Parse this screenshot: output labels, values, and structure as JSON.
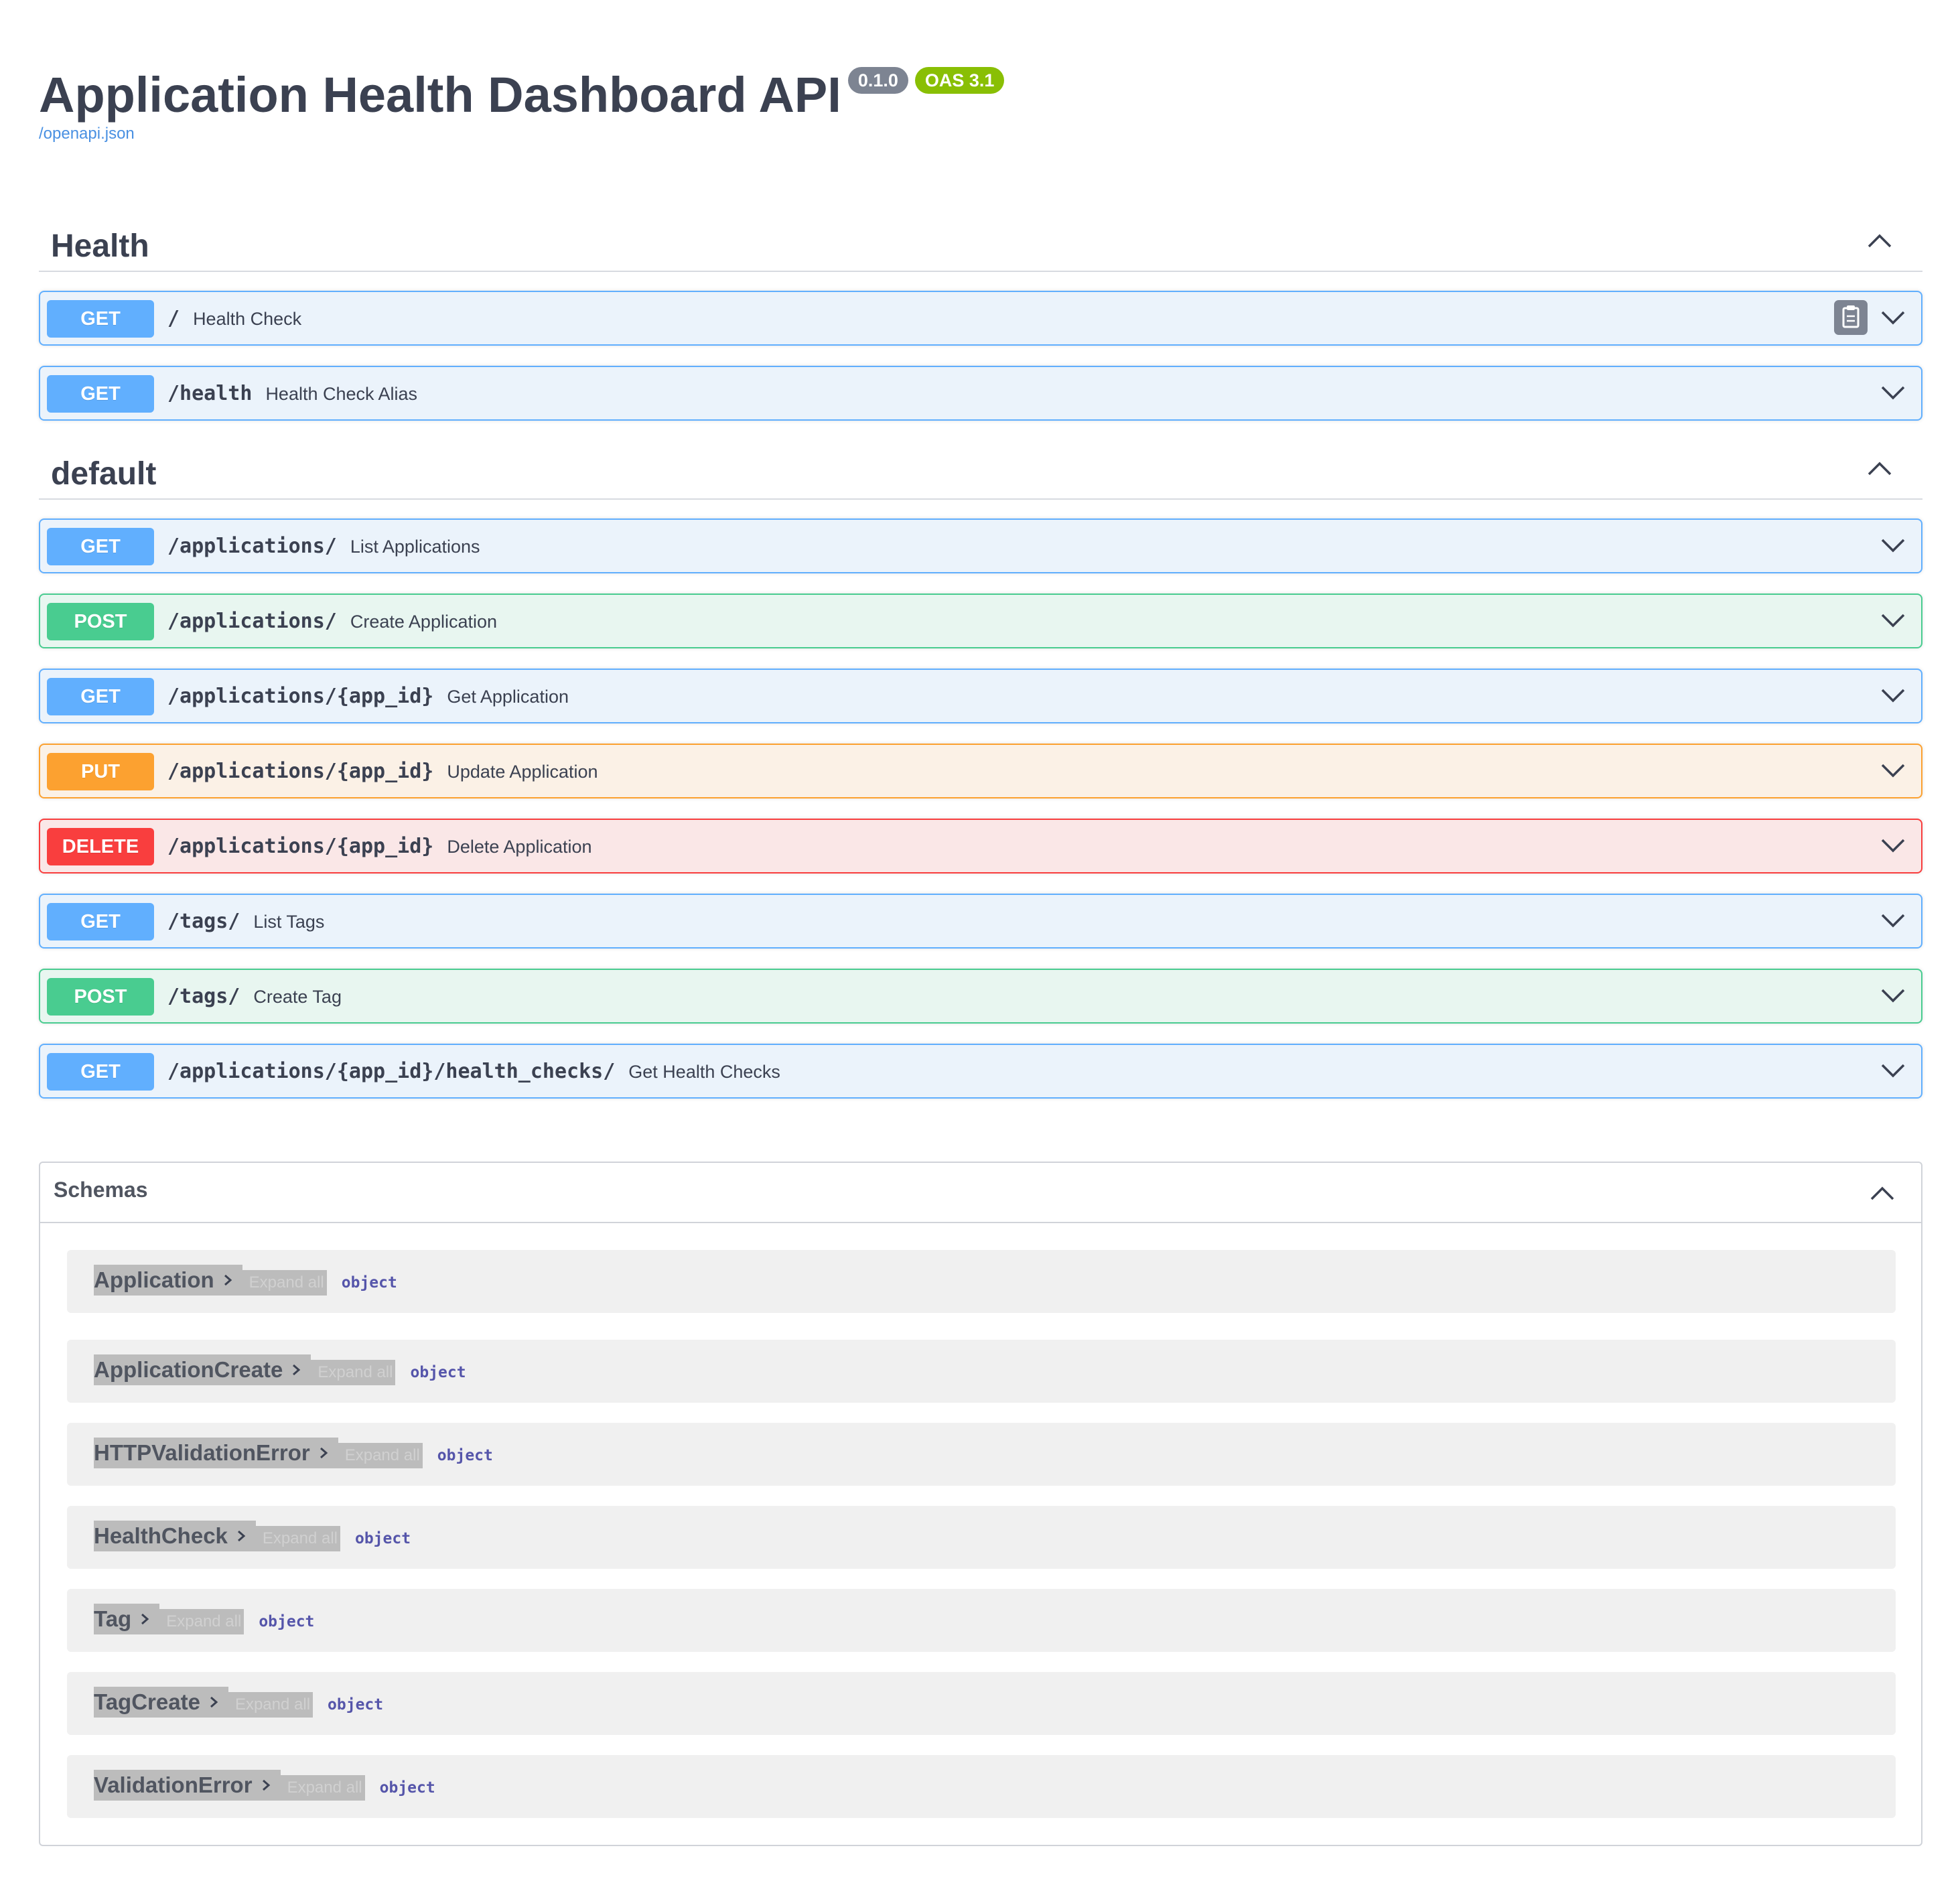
{
  "header": {
    "title": "Application Health Dashboard API",
    "version": "0.1.0",
    "oas": "OAS 3.1",
    "spec_link": "/openapi.json"
  },
  "sections": [
    {
      "name": "Health",
      "operations": [
        {
          "method": "GET",
          "path": "/",
          "summary": "Health Check"
        },
        {
          "method": "GET",
          "path": "/health",
          "summary": "Health Check Alias"
        }
      ]
    },
    {
      "name": "default",
      "operations": [
        {
          "method": "GET",
          "path": "/applications/",
          "summary": "List Applications"
        },
        {
          "method": "POST",
          "path": "/applications/",
          "summary": "Create Application"
        },
        {
          "method": "GET",
          "path": "/applications/{app_id}",
          "summary": "Get Application"
        },
        {
          "method": "PUT",
          "path": "/applications/{app_id}",
          "summary": "Update Application"
        },
        {
          "method": "DELETE",
          "path": "/applications/{app_id}",
          "summary": "Delete Application"
        },
        {
          "method": "GET",
          "path": "/tags/",
          "summary": "List Tags"
        },
        {
          "method": "POST",
          "path": "/tags/",
          "summary": "Create Tag"
        },
        {
          "method": "GET",
          "path": "/applications/{app_id}/health_checks/",
          "summary": "Get Health Checks"
        }
      ]
    }
  ],
  "schemas": {
    "title": "Schemas",
    "models": [
      {
        "name": "Application",
        "expand": "Expand all",
        "type": "object"
      },
      {
        "name": "ApplicationCreate",
        "expand": "Expand all",
        "type": "object"
      },
      {
        "name": "HTTPValidationError",
        "expand": "Expand all",
        "type": "object"
      },
      {
        "name": "HealthCheck",
        "expand": "Expand all",
        "type": "object"
      },
      {
        "name": "Tag",
        "expand": "Expand all",
        "type": "object"
      },
      {
        "name": "TagCreate",
        "expand": "Expand all",
        "type": "object"
      },
      {
        "name": "ValidationError",
        "expand": "Expand all",
        "type": "object"
      }
    ]
  },
  "colors": {
    "get": "#61affe",
    "post": "#49cc90",
    "put": "#fca130",
    "delete": "#f93e3e",
    "version_badge": "#7d8492",
    "oas_badge": "#89bf04"
  },
  "icons": {
    "collapse": "chevron-up-icon",
    "expand": "chevron-down-icon",
    "copy": "clipboard-icon",
    "model_caret": "chevron-right-icon"
  }
}
